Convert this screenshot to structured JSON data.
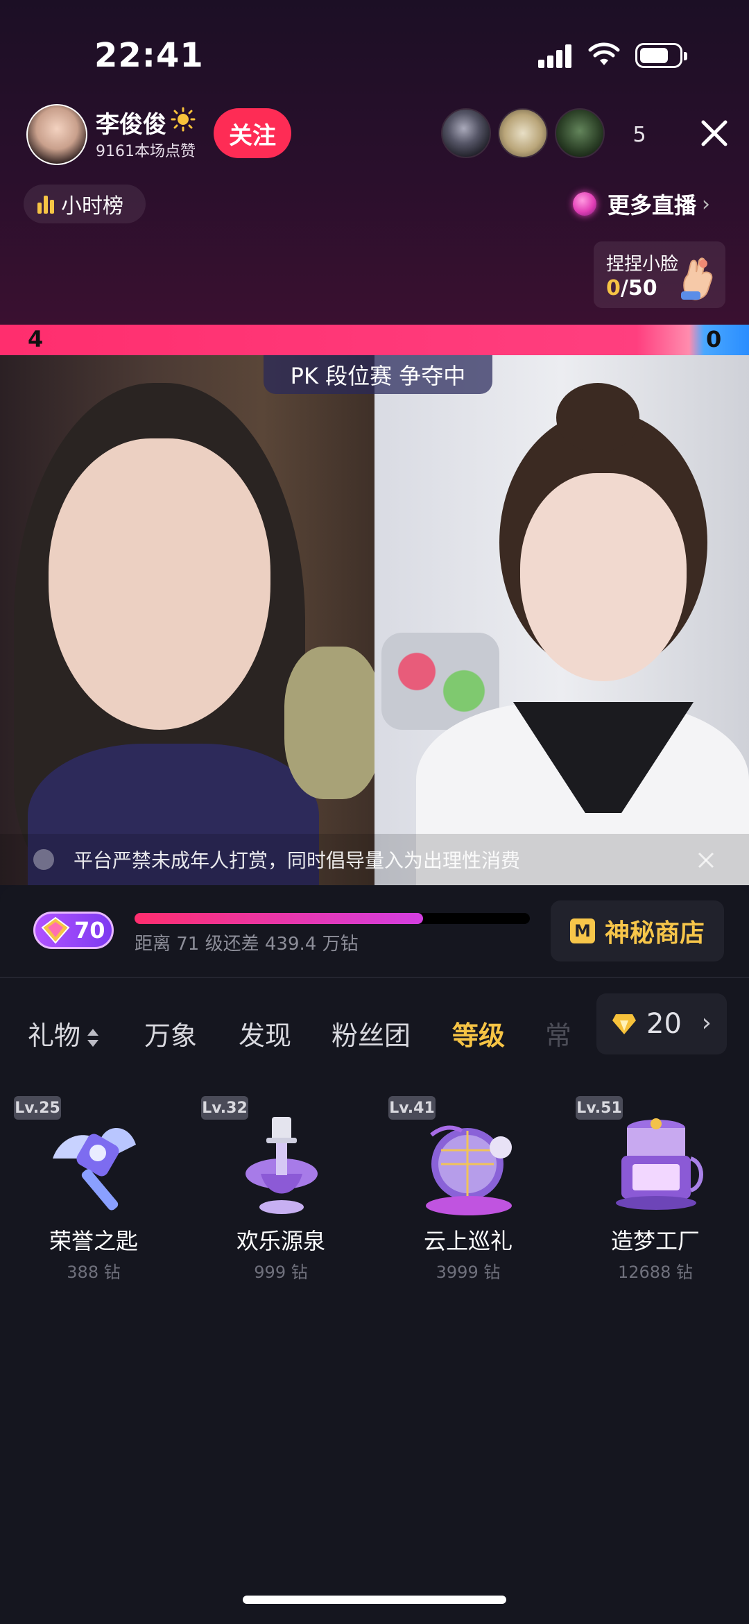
{
  "status_bar": {
    "time": "22:41"
  },
  "host": {
    "name": "李俊俊",
    "likes": "9161本场点赞",
    "follow_label": "关注"
  },
  "viewers": {
    "count": "5"
  },
  "hourly_rank": {
    "label": "小时榜"
  },
  "more_live": {
    "label": "更多直播"
  },
  "pinch_face": {
    "title": "捏捏小脸",
    "current": "0",
    "total": "/50"
  },
  "pk": {
    "left_score": "4",
    "right_score": "0",
    "label": "PK 段位赛 争夺中"
  },
  "notice": {
    "text": "平台严禁未成年人打赏，同时倡导量入为出理性消费"
  },
  "level": {
    "value": "70",
    "progress": 0.73,
    "progress_text": "距离 71 级还差 439.4 万钻"
  },
  "shop": {
    "label": "神秘商店"
  },
  "tabs": [
    {
      "label": "礼物"
    },
    {
      "label": "万象"
    },
    {
      "label": "发现"
    },
    {
      "label": "粉丝团"
    },
    {
      "label": "等级"
    },
    {
      "label": "常"
    }
  ],
  "balance": {
    "value": "20"
  },
  "gifts": [
    {
      "level": "Lv.25",
      "name": "荣誉之匙",
      "price": "388 钻",
      "icon": "winged-key-icon"
    },
    {
      "level": "Lv.32",
      "name": "欢乐源泉",
      "price": "999 钻",
      "icon": "fountain-icon"
    },
    {
      "level": "Lv.41",
      "name": "云上巡礼",
      "price": "3999 钻",
      "icon": "cloud-ship-icon"
    },
    {
      "level": "Lv.51",
      "name": "造梦工厂",
      "price": "12688 钻",
      "icon": "dream-factory-icon"
    }
  ],
  "colors": {
    "accent_pink": "#fe2c55",
    "gold": "#f6c445",
    "panel_bg": "#15161f"
  }
}
